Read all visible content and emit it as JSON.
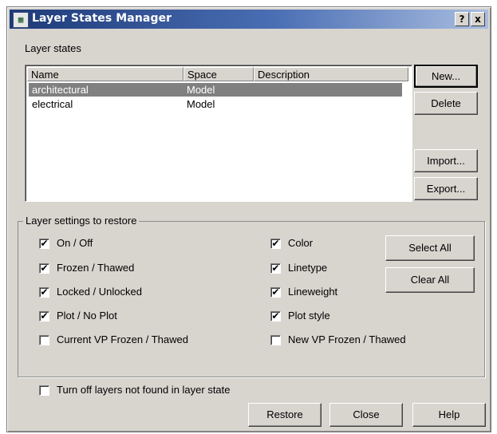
{
  "window": {
    "title": "Layer States Manager",
    "help_button": "?",
    "close_button": "x"
  },
  "layer_states": {
    "label": "Layer states",
    "columns": [
      "Name",
      "Space",
      "Description"
    ],
    "rows": [
      {
        "name": "architectural",
        "space": "Model",
        "description": "",
        "selected": true
      },
      {
        "name": "electrical",
        "space": "Model",
        "description": "",
        "selected": false
      }
    ]
  },
  "side_buttons": {
    "new": "New...",
    "delete": "Delete",
    "import": "Import...",
    "export": "Export..."
  },
  "settings": {
    "label": "Layer settings to restore",
    "left": [
      {
        "label": "On / Off",
        "checked": true
      },
      {
        "label": "Frozen / Thawed",
        "checked": true
      },
      {
        "label": "Locked / Unlocked",
        "checked": true
      },
      {
        "label": "Plot / No Plot",
        "checked": true
      },
      {
        "label": "Current VP Frozen / Thawed",
        "checked": false
      }
    ],
    "right": [
      {
        "label": "Color",
        "checked": true
      },
      {
        "label": "Linetype",
        "checked": true
      },
      {
        "label": "Lineweight",
        "checked": true
      },
      {
        "label": "Plot style",
        "checked": true
      },
      {
        "label": "New VP Frozen / Thawed",
        "checked": false
      }
    ],
    "select_all": "Select All",
    "clear_all": "Clear All"
  },
  "turn_off": {
    "label": "Turn off layers not found in layer state",
    "checked": false
  },
  "bottom_buttons": {
    "restore": "Restore",
    "close": "Close",
    "help": "Help"
  },
  "check_mark": "✔"
}
